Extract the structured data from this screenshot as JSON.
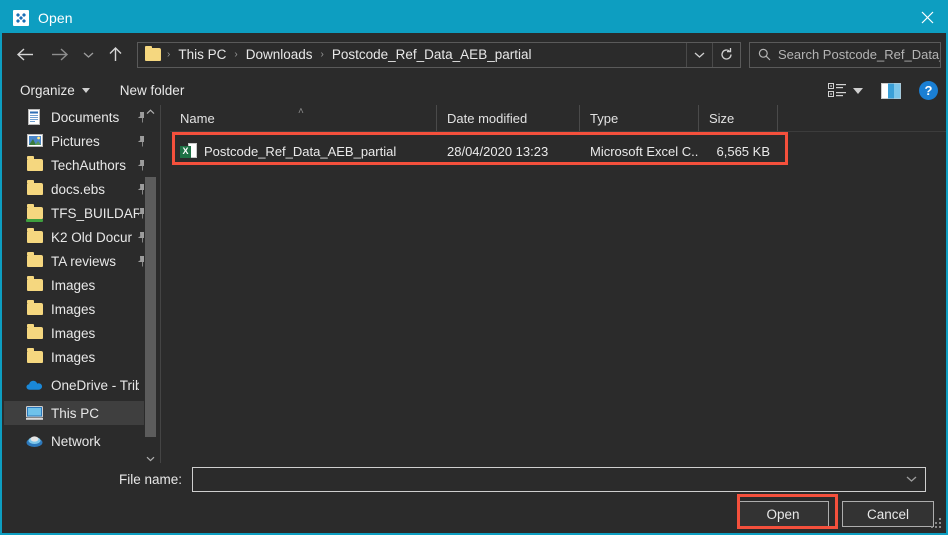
{
  "window": {
    "title": "Open",
    "icon": "app-dialog-icon",
    "close_label": "✕",
    "accent_color": "#0d9ec1",
    "highlight_color": "#f4503c"
  },
  "nav": {
    "back_label": "Back",
    "forward_label": "Forward",
    "recent_label": "Recent locations",
    "up_label": "Up one level",
    "breadcrumbs": [
      "This PC",
      "Downloads",
      "Postcode_Ref_Data_AEB_partial"
    ],
    "separator": "›",
    "dropdown_label": "Previous locations",
    "refresh_label": "Refresh"
  },
  "search": {
    "placeholder": "Search Postcode_Ref_Data_A...",
    "icon": "search-icon"
  },
  "toolbar": {
    "organize_label": "Organize",
    "new_folder_label": "New folder",
    "view_options_label": "Change your view",
    "preview_pane_label": "Show the preview pane",
    "help_label": "?"
  },
  "sidebar": {
    "items": [
      {
        "label": "Documents",
        "icon": "documents-icon",
        "pinned": true,
        "selected": false
      },
      {
        "label": "Pictures",
        "icon": "pictures-icon",
        "pinned": true,
        "selected": false
      },
      {
        "label": "TechAuthors",
        "icon": "folder-icon",
        "pinned": true,
        "selected": false
      },
      {
        "label": "docs.ebs",
        "icon": "folder-icon",
        "pinned": true,
        "selected": false
      },
      {
        "label": "TFS_BUILDAR",
        "icon": "shared-folder-icon",
        "pinned": true,
        "selected": false
      },
      {
        "label": "K2 Old Docur",
        "icon": "folder-icon",
        "pinned": true,
        "selected": false
      },
      {
        "label": "TA reviews",
        "icon": "folder-icon",
        "pinned": true,
        "selected": false
      },
      {
        "label": "Images",
        "icon": "folder-icon",
        "pinned": false,
        "selected": false
      },
      {
        "label": "Images",
        "icon": "folder-icon",
        "pinned": false,
        "selected": false
      },
      {
        "label": "Images",
        "icon": "folder-icon",
        "pinned": false,
        "selected": false
      },
      {
        "label": "Images",
        "icon": "folder-icon",
        "pinned": false,
        "selected": false
      },
      {
        "label": "OneDrive - Tribal E",
        "icon": "onedrive-icon",
        "pinned": false,
        "selected": false
      },
      {
        "label": "This PC",
        "icon": "this-pc-icon",
        "pinned": false,
        "selected": true
      },
      {
        "label": "Network",
        "icon": "network-icon",
        "pinned": false,
        "selected": false
      }
    ]
  },
  "filelist": {
    "columns": [
      "Name",
      "Date modified",
      "Type",
      "Size"
    ],
    "sort_indicator": "˄",
    "rows": [
      {
        "name": "Postcode_Ref_Data_AEB_partial",
        "date_modified": "28/04/2020 13:23",
        "type": "Microsoft Excel C...",
        "size": "6,565 KB",
        "icon": "excel-file-icon",
        "icon_text": "X",
        "highlighted": true
      }
    ]
  },
  "footer": {
    "filename_label": "File name:",
    "filename_value": "",
    "filename_placeholder": "",
    "open_label": "Open",
    "cancel_label": "Cancel"
  }
}
